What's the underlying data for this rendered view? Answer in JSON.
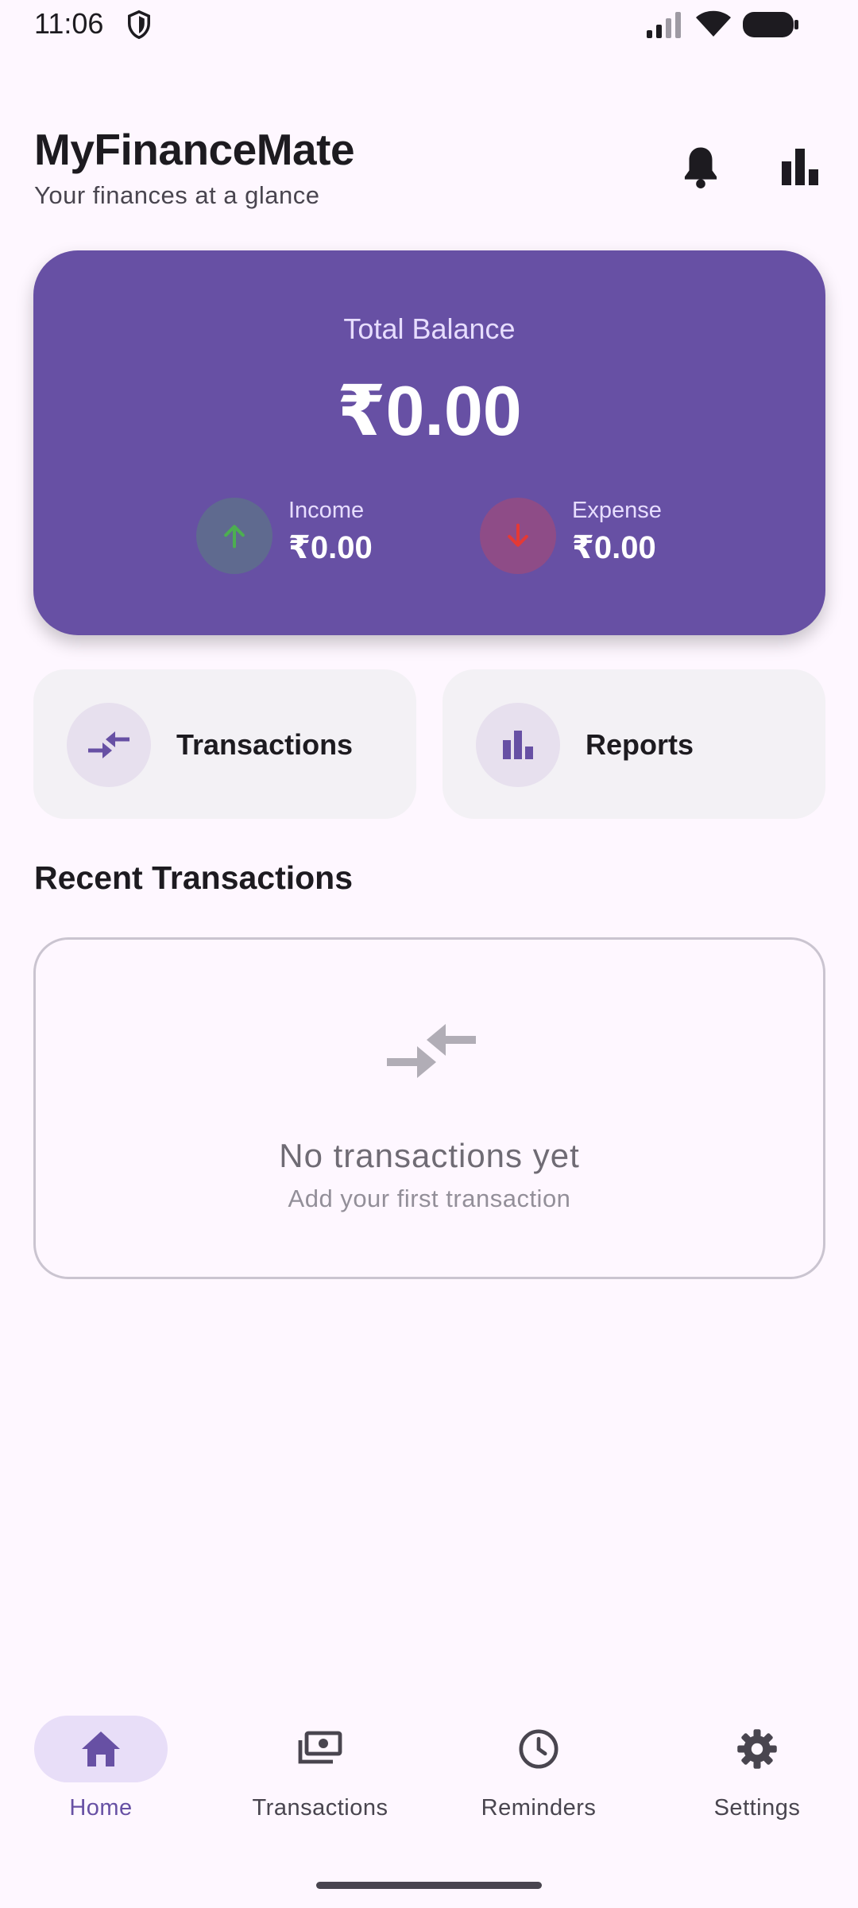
{
  "status_bar": {
    "time": "11:06"
  },
  "header": {
    "title": "MyFinanceMate",
    "subtitle": "Your finances at a glance",
    "notifications_icon": "bell-icon",
    "reports_icon": "bar-chart-icon"
  },
  "balance_card": {
    "label": "Total Balance",
    "value": "₹0.00",
    "income": {
      "label": "Income",
      "value": "₹0.00",
      "icon": "arrow-up-icon"
    },
    "expense": {
      "label": "Expense",
      "value": "₹0.00",
      "icon": "arrow-down-icon"
    }
  },
  "quick_actions": [
    {
      "label": "Transactions",
      "icon": "swap-arrows-icon"
    },
    {
      "label": "Reports",
      "icon": "bar-chart-icon"
    }
  ],
  "recent_transactions": {
    "title": "Recent Transactions",
    "empty_title": "No transactions yet",
    "empty_subtitle": "Add your first transaction"
  },
  "bottom_nav": {
    "items": [
      {
        "label": "Home",
        "icon": "home-icon",
        "active": true
      },
      {
        "label": "Transactions",
        "icon": "money-icon",
        "active": false
      },
      {
        "label": "Reminders",
        "icon": "clock-icon",
        "active": false
      },
      {
        "label": "Settings",
        "icon": "gear-icon",
        "active": false
      }
    ]
  },
  "colors": {
    "primary": "#6750A4",
    "background": "#FEF7FF",
    "income_arrow": "#4CAF50",
    "expense_arrow": "#E53935"
  }
}
